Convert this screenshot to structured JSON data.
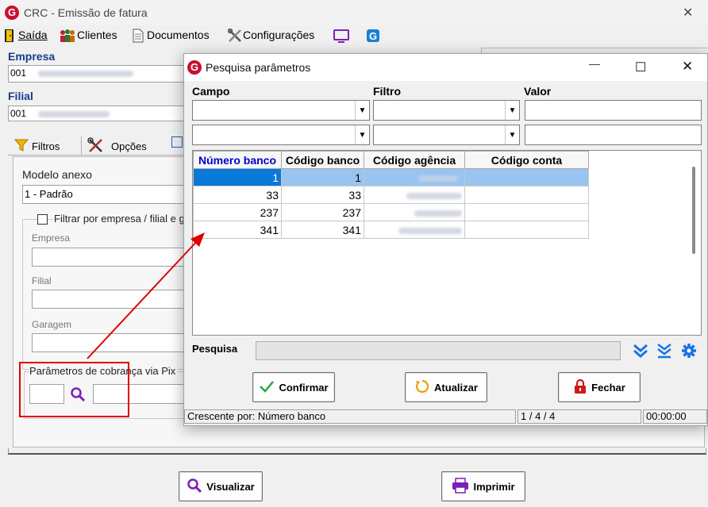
{
  "window": {
    "title": "CRC - Emissão de fatura",
    "logo_letter": "G",
    "close_glyph": "✕"
  },
  "menu": {
    "items": [
      {
        "label": "Saída",
        "icon": "exit-door-icon"
      },
      {
        "label": "Clientes",
        "icon": "users-icon"
      },
      {
        "label": "Documentos",
        "icon": "document-icon"
      },
      {
        "label": "Configurações",
        "icon": "tools-icon"
      },
      {
        "label": "",
        "icon": "monitor-icon"
      },
      {
        "label": "",
        "icon": "app-logo-icon"
      }
    ]
  },
  "form": {
    "empresa_label": "Empresa",
    "empresa_value": "001",
    "filial_label": "Filial",
    "filial_value": "001",
    "tabs": [
      {
        "label": "Filtros",
        "icon": "funnel-icon"
      },
      {
        "label": "Opções",
        "icon": "tools-icon"
      }
    ],
    "modelo_label": "Modelo anexo",
    "modelo_value": "1 - Padrão",
    "filter_check_label": "Filtrar por empresa / filial e g",
    "empresa_sub_label": "Empresa",
    "filial_sub_label": "Filial",
    "garagem_label": "Garagem",
    "pix_group_label": "Parâmetros de cobrança via Pix",
    "highlight_color": "#e00000"
  },
  "bottom_buttons": {
    "visualizar": "Visualizar",
    "imprimir": "Imprimir"
  },
  "dialog": {
    "title": "Pesquisa parâmetros",
    "minimize_glyph": "—",
    "maximize_glyph": "☐",
    "close_glyph": "✕",
    "campo_label": "Campo",
    "filtro_label": "Filtro",
    "valor_label": "Valor",
    "grid": {
      "columns": [
        "Número banco",
        "Código banco",
        "Código agência",
        "Código conta"
      ],
      "rows": [
        [
          "1",
          "1",
          "",
          ""
        ],
        [
          "33",
          "33",
          "",
          ""
        ],
        [
          "237",
          "237",
          "",
          ""
        ],
        [
          "341",
          "341",
          "",
          ""
        ]
      ],
      "active_column_color": "#0000cc",
      "selected_row_color": "#0a78d7"
    },
    "pesquisa_label": "Pesquisa",
    "buttons": {
      "confirmar": "Confirmar",
      "atualizar": "Atualizar",
      "fechar": "Fechar"
    },
    "status": {
      "sort": "Crescente por: Número banco",
      "records": "1 / 4 / 4",
      "time": "00:00:00"
    }
  }
}
